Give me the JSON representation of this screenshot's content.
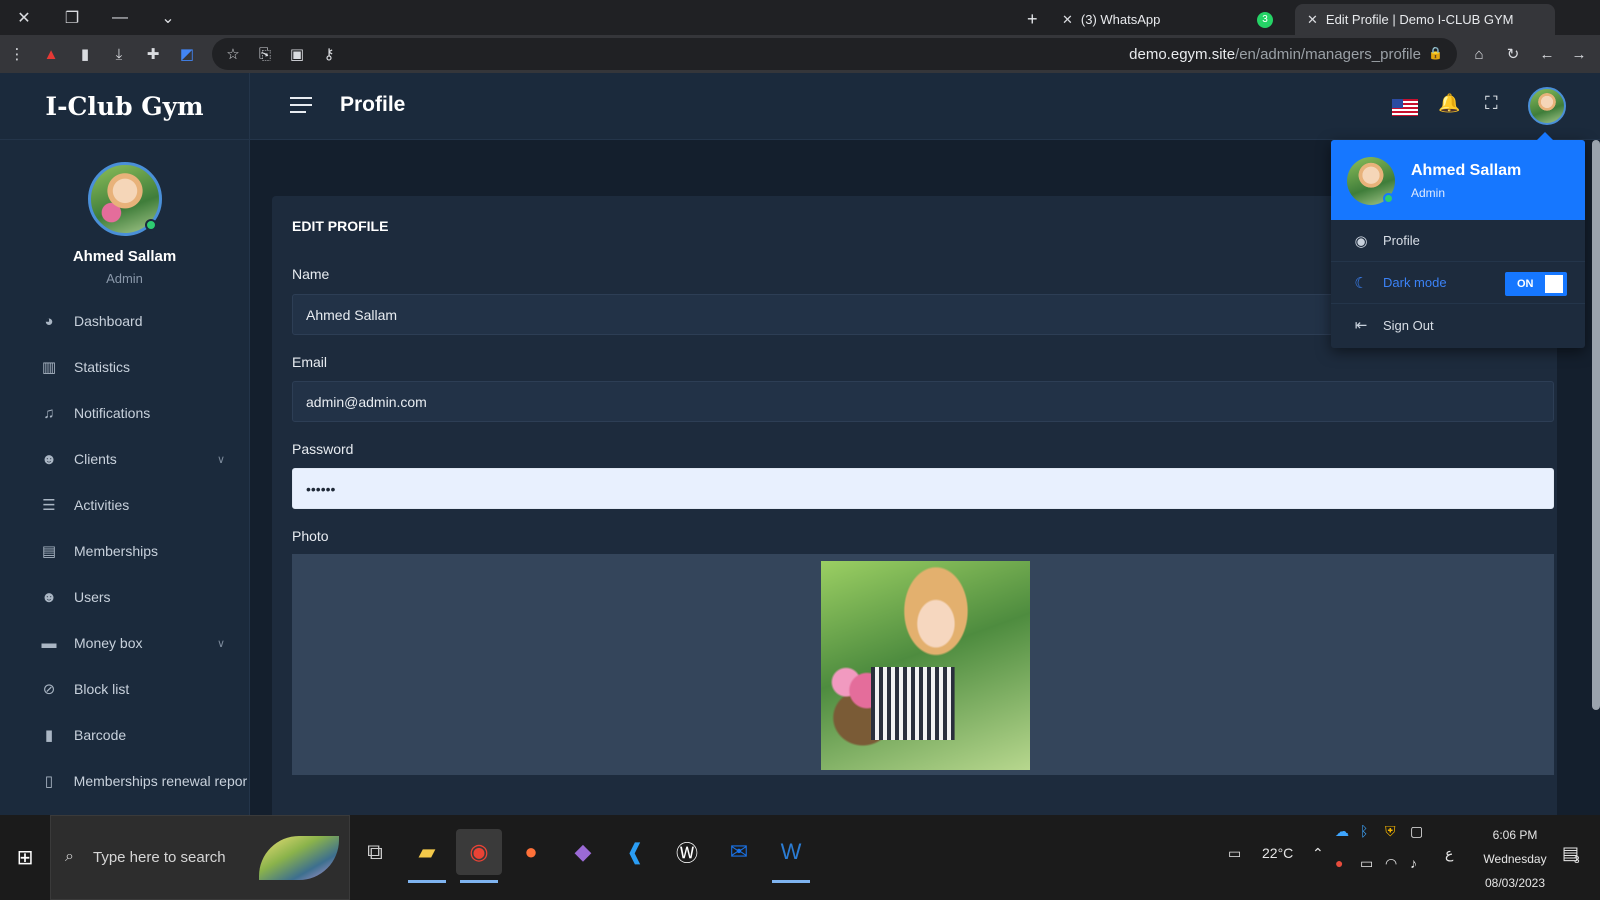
{
  "browser": {
    "tabs": [
      {
        "title": "(3) WhatsApp",
        "badge": "3"
      },
      {
        "title": "Edit Profile | Demo I-CLUB GYM"
      }
    ],
    "url_host": "demo.egym.site",
    "url_path": "/en/admin/managers_profile"
  },
  "sidebar": {
    "brand": "I-Club Gym",
    "user_name": "Ahmed Sallam",
    "user_role": "Admin",
    "items": [
      {
        "label": "Dashboard",
        "icon": "dashboard-icon"
      },
      {
        "label": "Statistics",
        "icon": "bar-chart-icon"
      },
      {
        "label": "Notifications",
        "icon": "bell-icon"
      },
      {
        "label": "Clients",
        "icon": "users-icon",
        "has_submenu": true
      },
      {
        "label": "Activities",
        "icon": "list-icon"
      },
      {
        "label": "Memberships",
        "icon": "id-card-icon"
      },
      {
        "label": "Users",
        "icon": "users-icon"
      },
      {
        "label": "Money box",
        "icon": "money-icon",
        "has_submenu": true
      },
      {
        "label": "Block list",
        "icon": "ban-icon"
      },
      {
        "label": "Barcode",
        "icon": "barcode-icon"
      },
      {
        "label": "Memberships renewal repor",
        "icon": "file-icon"
      }
    ]
  },
  "header": {
    "title": "Profile"
  },
  "form": {
    "title": "EDIT PROFILE",
    "name_label": "Name",
    "name_value": "Ahmed Sallam",
    "email_label": "Email",
    "email_value": "admin@admin.com",
    "password_label": "Password",
    "password_value": "••••••",
    "photo_label": "Photo"
  },
  "dropdown": {
    "name": "Ahmed Sallam",
    "role": "Admin",
    "profile_label": "Profile",
    "dark_mode_label": "Dark mode",
    "dark_mode_state": "ON",
    "sign_out_label": "Sign Out"
  },
  "taskbar": {
    "search_placeholder": "Type here to search",
    "weather": "22°C",
    "time": "6:06 PM",
    "day": "Wednesday",
    "date": "08/03/2023",
    "notification_count": "3",
    "lang": "ع"
  },
  "colors": {
    "accent": "#1677ff",
    "sidebar_bg": "#1b2a3c",
    "main_bg": "#141f2d"
  }
}
